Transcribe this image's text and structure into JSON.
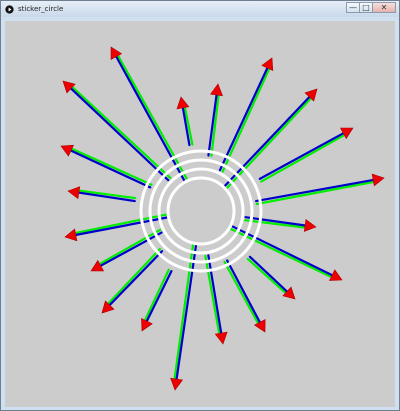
{
  "window": {
    "title": "sticker_circle",
    "icons": {
      "app": "play-circle-icon",
      "minimize": "minimize-icon",
      "maximize": "maximize-icon",
      "close": "close-icon"
    },
    "control_glyphs": {
      "minimize": "—",
      "maximize": "□",
      "close": "✕"
    }
  },
  "sketch": {
    "background": "#cccccc",
    "ring_color": "#ffffff",
    "arrow_color": "#0000cc",
    "shadow_color": "#00ee00",
    "head_color": "#ee0000",
    "rings": 4,
    "arrows": 24
  }
}
